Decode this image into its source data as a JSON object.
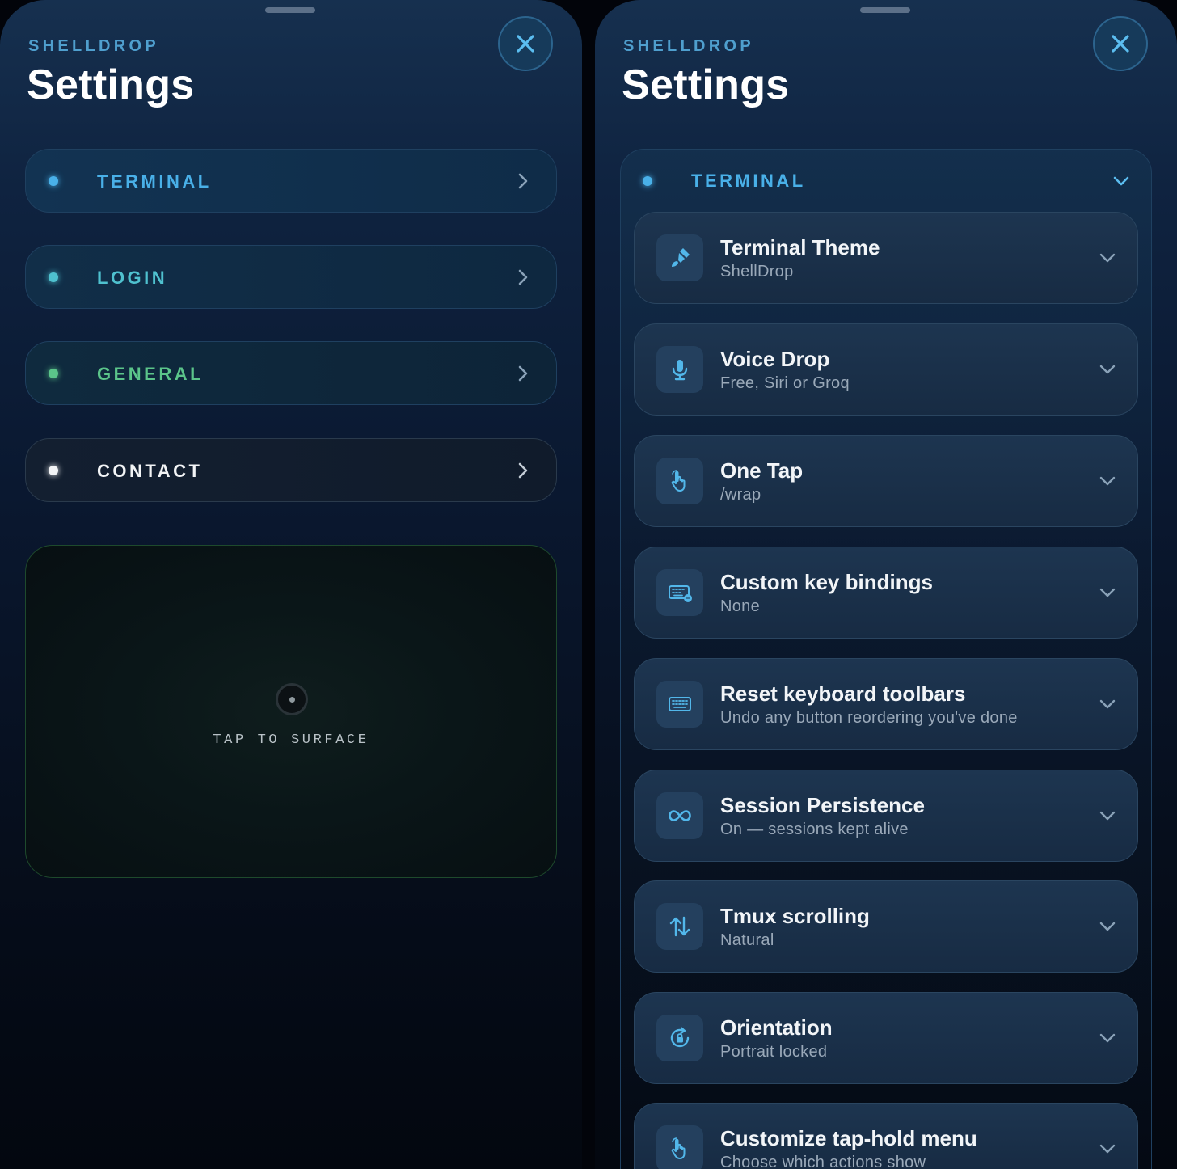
{
  "colors": {
    "terminal": "#49b0e8",
    "login": "#4fc1cf",
    "general": "#5bc58a",
    "contact": "#f2f4f6",
    "accent_icon": "#52b7ea",
    "chevron": "#8aa2b8"
  },
  "left": {
    "brand": "SHELLDROP",
    "title": "Settings",
    "close_icon": "close-icon",
    "sections": [
      {
        "label": "TERMINAL",
        "color": "#49b0e8"
      },
      {
        "label": "LOGIN",
        "color": "#4fc1cf"
      },
      {
        "label": "GENERAL",
        "color": "#5bc58a"
      },
      {
        "label": "CONTACT",
        "color": "#f2f4f6"
      }
    ],
    "surface": {
      "label": "TAP TO SURFACE"
    }
  },
  "right": {
    "brand": "SHELLDROP",
    "title": "Settings",
    "group": {
      "label": "TERMINAL",
      "color": "#49b0e8"
    },
    "items": [
      {
        "title": "Terminal Theme",
        "subtitle": "ShellDrop",
        "icon": "paintbrush-icon"
      },
      {
        "title": "Voice Drop",
        "subtitle": "Free, Siri or Groq",
        "icon": "microphone-icon"
      },
      {
        "title": "One Tap",
        "subtitle": "/wrap",
        "icon": "tap-hand-icon"
      },
      {
        "title": "Custom key bindings",
        "subtitle": "None",
        "icon": "keyboard-badge-icon"
      },
      {
        "title": "Reset keyboard toolbars",
        "subtitle": "Undo any button reordering you've done",
        "icon": "keyboard-icon"
      },
      {
        "title": "Session Persistence",
        "subtitle": "On — sessions kept alive",
        "icon": "infinity-icon"
      },
      {
        "title": "Tmux scrolling",
        "subtitle": "Natural",
        "icon": "arrows-updown-icon"
      },
      {
        "title": "Orientation",
        "subtitle": "Portrait locked",
        "icon": "rotation-lock-icon"
      },
      {
        "title": "Customize tap-hold menu",
        "subtitle": "Choose which actions show",
        "icon": "tap-hand-icon"
      }
    ]
  }
}
